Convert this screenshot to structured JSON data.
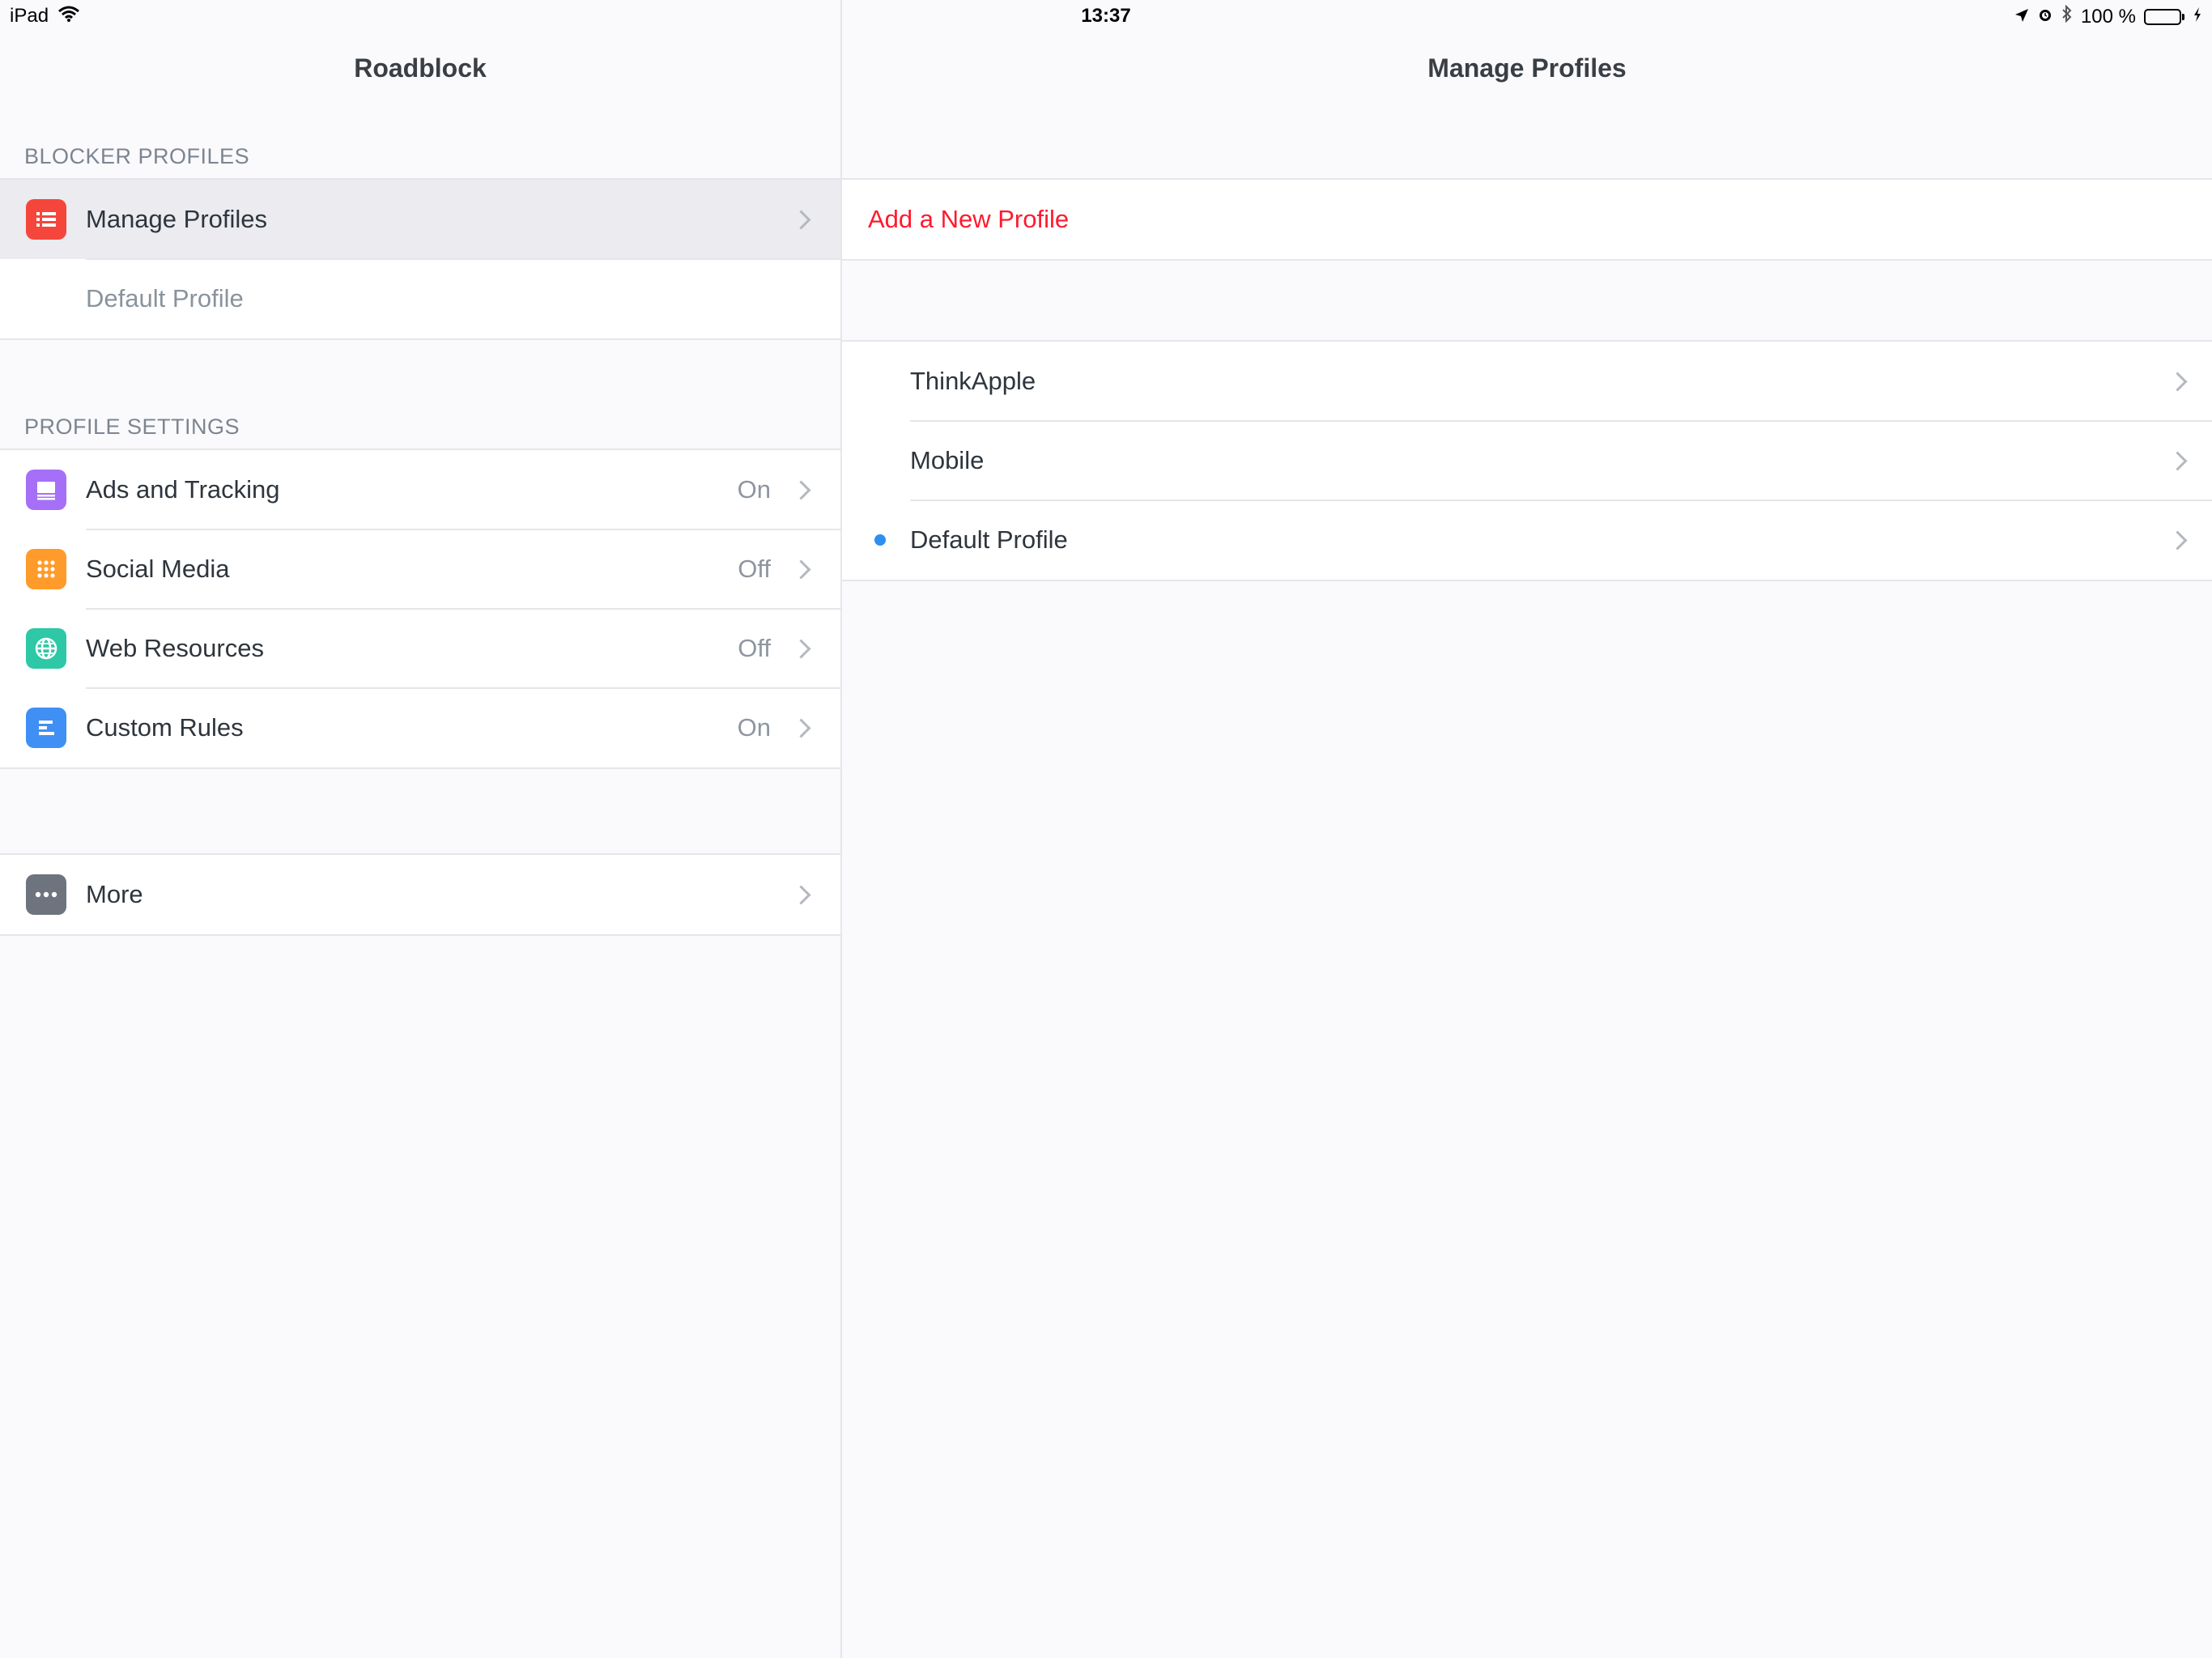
{
  "status_bar": {
    "device": "iPad",
    "time": "13:37",
    "battery": "100 %",
    "battery_level": 1.0
  },
  "master": {
    "title": "Roadblock",
    "blocker_profiles": {
      "header": "BLOCKER PROFILES",
      "items": [
        {
          "label": "Manage Profiles",
          "icon": "list-icon",
          "color": "#f5463c",
          "selected": true
        },
        {
          "label": "Default Profile"
        }
      ]
    },
    "profile_settings": {
      "header": "PROFILE SETTINGS",
      "items": [
        {
          "label": "Ads and Tracking",
          "value": "On",
          "icon": "ads-icon",
          "color": "#a66ff7"
        },
        {
          "label": "Social Media",
          "value": "Off",
          "icon": "grid-icon",
          "color": "#fe9b2a"
        },
        {
          "label": "Web Resources",
          "value": "Off",
          "icon": "globe-icon",
          "color": "#2ec8a6"
        },
        {
          "label": "Custom Rules",
          "value": "On",
          "icon": "rules-icon",
          "color": "#3f8ff5"
        }
      ]
    },
    "more": {
      "label": "More",
      "icon": "ellipsis-icon",
      "color": "#6d747d"
    }
  },
  "detail": {
    "title": "Manage Profiles",
    "add_label": "Add a New Profile",
    "profiles": [
      {
        "label": "ThinkApple",
        "active": false
      },
      {
        "label": "Mobile",
        "active": false
      },
      {
        "label": "Default Profile",
        "active": true
      }
    ],
    "accent_color": "#ff1a2e",
    "active_dot_color": "#2d8ff0"
  }
}
